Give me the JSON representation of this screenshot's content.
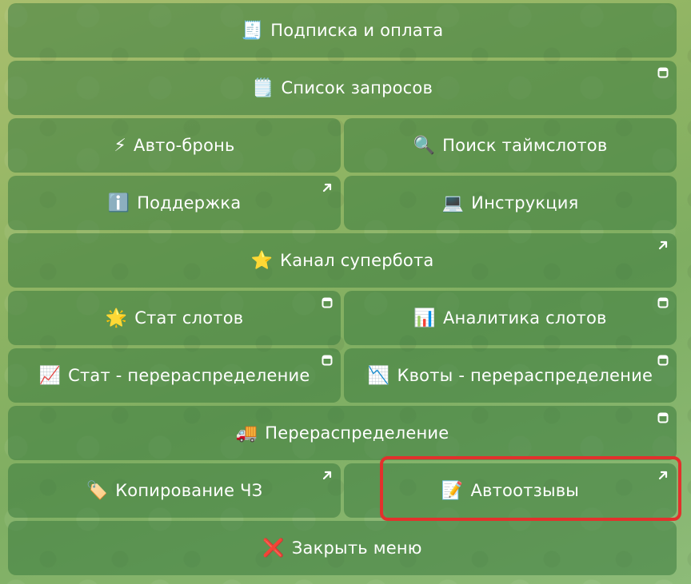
{
  "keyboard": {
    "buttons": {
      "subscription": {
        "icon": "receipt-icon",
        "emoji": "🧾",
        "label": "Подписка и оплата"
      },
      "request_list": {
        "icon": "notepad-icon",
        "emoji": "🗒️",
        "label": "Список запросов",
        "corner": "web-app-icon"
      },
      "auto_booking": {
        "icon": "lightning-icon",
        "emoji": "⚡",
        "label": "Авто-бронь"
      },
      "timeslot_search": {
        "icon": "magnifier-icon",
        "emoji": "🔍",
        "label": "Поиск таймслотов"
      },
      "support": {
        "icon": "info-icon",
        "emoji": "ℹ️",
        "label": "Поддержка",
        "corner": "external-link-icon"
      },
      "instruction": {
        "icon": "laptop-icon",
        "emoji": "💻",
        "label": "Инструкция"
      },
      "channel": {
        "icon": "star-icon",
        "emoji": "⭐",
        "label": "Канал супербота",
        "corner": "external-link-icon"
      },
      "slot_stats": {
        "icon": "glowing-star-icon",
        "emoji": "🌟",
        "label": "Стат слотов",
        "corner": "web-app-icon"
      },
      "slot_analytics": {
        "icon": "bar-chart-icon",
        "emoji": "📊",
        "label": "Аналитика слотов",
        "corner": "web-app-icon"
      },
      "redistribution_stats": {
        "icon": "chart-up-icon",
        "emoji": "📈",
        "label": "Стат - перераспределение",
        "corner": "web-app-icon"
      },
      "redistribution_quotas": {
        "icon": "chart-down-icon",
        "emoji": "📉",
        "label": "Квоты - перераспределение",
        "corner": "web-app-icon"
      },
      "redistribution": {
        "icon": "truck-icon",
        "emoji": "🚚",
        "label": "Перераспределение",
        "corner": "web-app-icon"
      },
      "copy_cz": {
        "icon": "tag-icon",
        "emoji": "🏷️",
        "label": "Копирование ЧЗ",
        "corner": "external-link-icon"
      },
      "auto_reviews": {
        "icon": "memo-icon",
        "emoji": "📝",
        "label": "Автоотзывы",
        "corner": "external-link-icon"
      },
      "close_menu": {
        "icon": "cross-mark-icon",
        "emoji": "❌",
        "label": "Закрыть меню"
      }
    }
  },
  "colors": {
    "highlight": "#e2312c",
    "button_text": "#ffffff"
  }
}
